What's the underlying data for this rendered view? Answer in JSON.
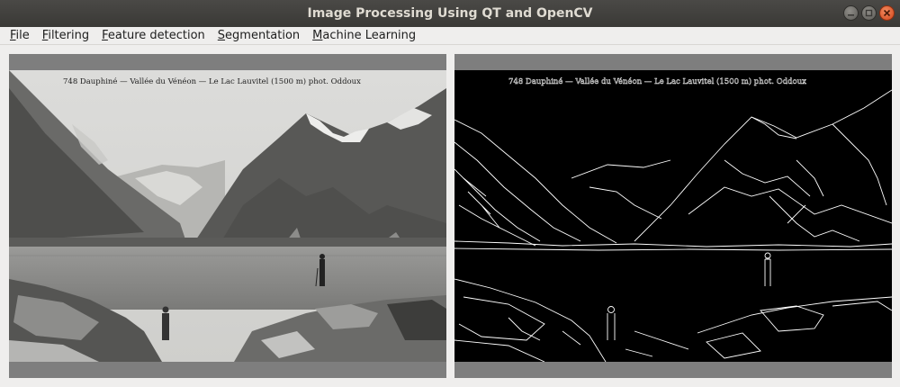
{
  "window": {
    "title": "Image Processing Using QT and OpenCV",
    "controls": [
      "minimize-icon",
      "maximize-icon",
      "close-icon"
    ]
  },
  "menu": {
    "items": [
      {
        "mnemonic": "F",
        "rest": "ile"
      },
      {
        "mnemonic": "F",
        "rest": "iltering"
      },
      {
        "mnemonic": "F",
        "rest": "eature detection"
      },
      {
        "mnemonic": "S",
        "rest": "egmentation"
      },
      {
        "mnemonic": "M",
        "rest": "achine Learning"
      }
    ]
  },
  "images": {
    "original_caption": "748 Dauphiné — Vallée du Vénéon — Le Lac Lauvitel (1500 m) phot. Oddoux",
    "processed_caption": "748 Dauphiné — Vallée du Vénéon — Le Lac Lauvitel (1500 m) phot. Oddoux"
  },
  "colors": {
    "titlebar": "#3c3b37",
    "panel_bg": "#7e7e7e",
    "close_button": "#e05a28"
  }
}
